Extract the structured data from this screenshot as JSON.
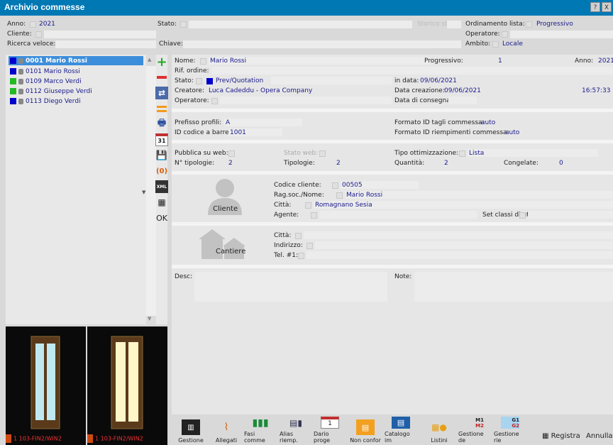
{
  "window": {
    "title": "Archivio commesse",
    "help_btn": "?",
    "close_btn": "X"
  },
  "filters": {
    "anno_label": "Anno:",
    "anno_value": "2021",
    "stato_label": "Stato:",
    "storico_label": "Storico stati:",
    "ordinamento_label": "Ordinamento lista:",
    "ordinamento_value": "Progressivo",
    "cliente_label": "Cliente:",
    "operatore_label": "Operatore:",
    "ricerca_label": "Ricerca veloce:",
    "chiave_label": "Chiave:",
    "ambito_label": "Ambito:",
    "ambito_value": "Locale"
  },
  "list": {
    "items": [
      {
        "label": "0001 Mario Rossi",
        "color": "#0000cc"
      },
      {
        "label": "0101 Mario Rossi",
        "color": "#0000cc"
      },
      {
        "label": "0109 Marco Verdi",
        "color": "#22bb22"
      },
      {
        "label": "0112 Giuseppe Verdi",
        "color": "#22bb22"
      },
      {
        "label": "0113 Diego Verdi",
        "color": "#0000cc"
      }
    ]
  },
  "tools": {
    "calendar": "31",
    "xml": "XML",
    "ok": "OK"
  },
  "detail": {
    "nome_label": "Nome:",
    "nome_value": "Mario Rossi",
    "progressivo_label": "Progressivo:",
    "progressivo_value": "1",
    "anno_label": "Anno:",
    "anno_value": "2021",
    "rif_label": "Rif. ordine:",
    "stato_label": "Stato:",
    "stato_value": "Prev/Quotation",
    "indata_label": "in data:",
    "indata_value": "09/06/2021",
    "creatore_label": "Creatore:",
    "creatore_value": "Luca Cadeddu - Opera Company",
    "datacreazione_label": "Data creazione:",
    "datacreazione_value": "09/06/2021",
    "ora_value": "16:57:33",
    "operatore_label": "Operatore:",
    "dataconsegna_label": "Data di consegna:",
    "prefisso_label": "Prefisso profili:",
    "prefisso_value": "A",
    "formato_tagli_label": "Formato ID tagli commessa:",
    "formato_tagli_value": "auto",
    "idcodice_label": "ID codice a barre:",
    "idcodice_value": "1001",
    "formato_riemp_label": "Formato ID riempimenti commessa:",
    "formato_riemp_value": "auto",
    "pubblica_label": "Pubblica su web:",
    "statoweb_label": "Stato web:",
    "tipoottim_label": "Tipo ottimizzazione:",
    "tipoottim_value": "Lista",
    "ntipologie_label": "N° tipologie:",
    "ntipologie_value": "2",
    "tipologie_label": "Tipologie:",
    "tipologie_value": "2",
    "quantita_label": "Quantità:",
    "quantita_value": "2",
    "congelate_label": "Congelate:",
    "congelate_value": "0",
    "cliente_caption": "Cliente",
    "codcliente_label": "Codice cliente:",
    "codcliente_value": "00505",
    "ragsoc_label": "Rag.soc./Nome:",
    "ragsoc_value": "Mario Rossi",
    "citta_label": "Città:",
    "citta_value": "Romagnano Sesia",
    "agente_label": "Agente:",
    "setclassi_label": "Set classi di utile:",
    "cantiere_caption": "Cantiere",
    "cantiere_citta_label": "Città:",
    "indirizzo_label": "Indirizzo:",
    "tel_label": "Tel. #1:",
    "desc_label": "Desc:",
    "note_label": "Note:"
  },
  "previews": [
    {
      "caption": "1 103-FIN2/WIN2",
      "count_prefix": "1×"
    },
    {
      "caption": "1 103-FIN2/WIN2",
      "count_prefix": "1×"
    }
  ],
  "bottom": {
    "buttons": [
      "Gestione",
      "Allegati",
      "Fasi comme",
      "Alias riemp.",
      "Dario proge",
      "Non confor",
      "Catalogo im",
      "Listini",
      "Gestione de",
      "Gestione rie"
    ],
    "m1": "M1",
    "m2": "M2",
    "g1": "G1",
    "g2": "G2",
    "registra": "Registra",
    "annulla": "Annulla"
  }
}
